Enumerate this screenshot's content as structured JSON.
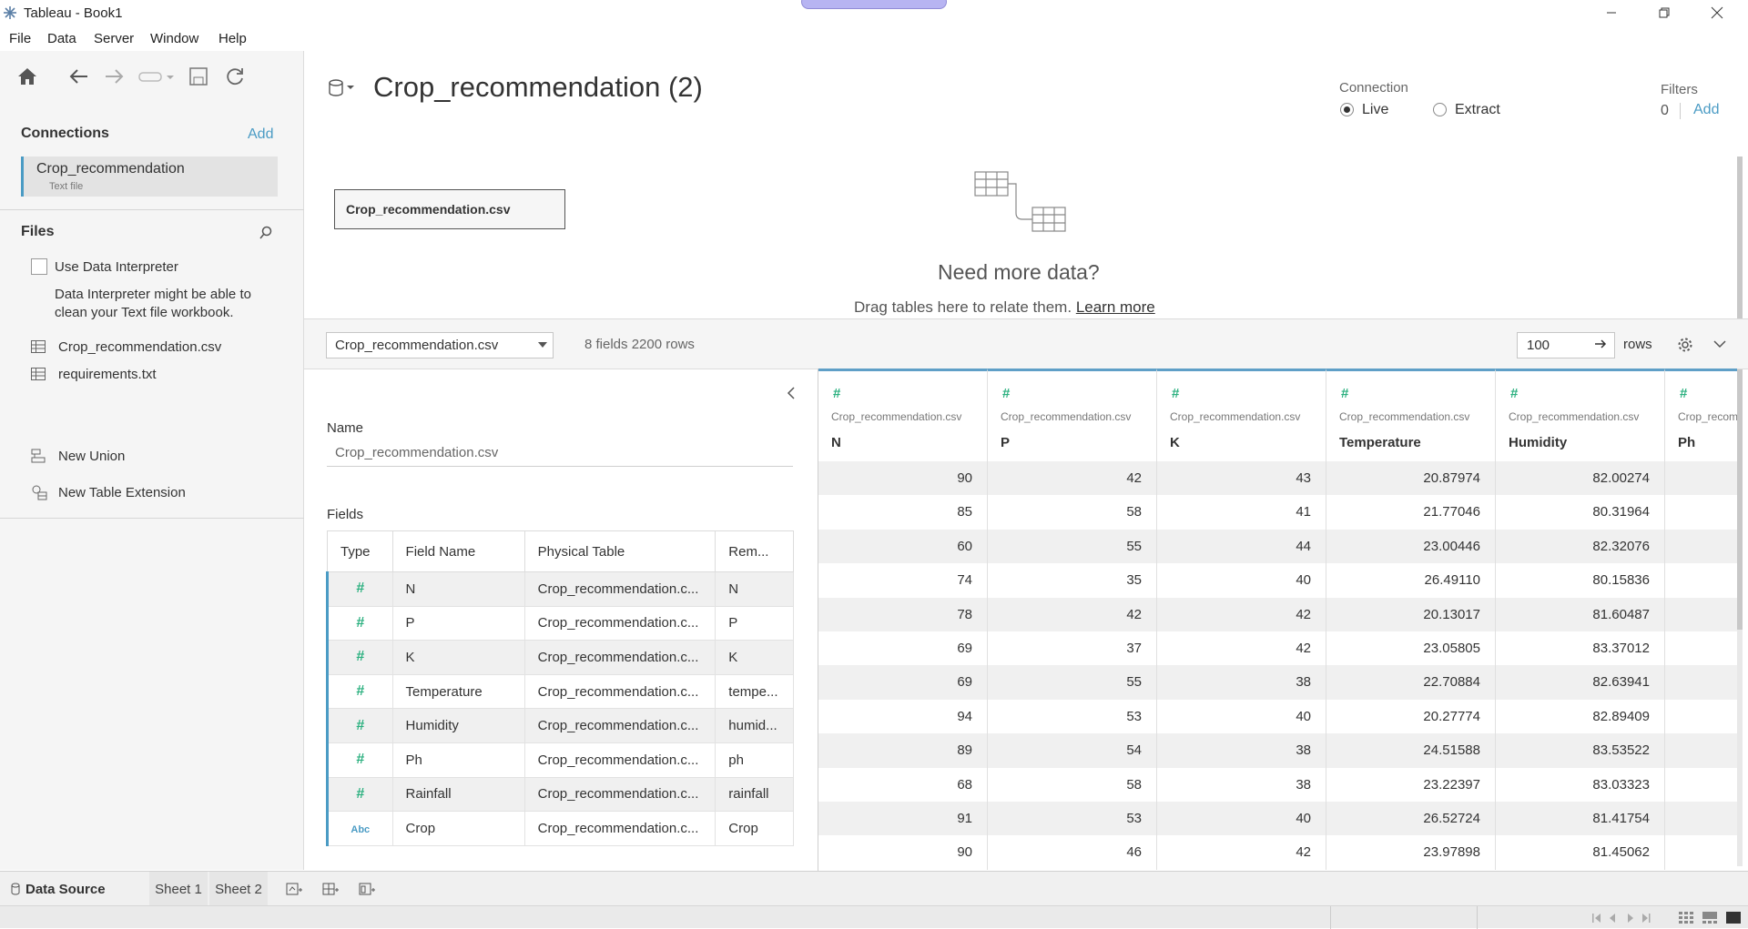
{
  "window": {
    "title": "Tableau - Book1"
  },
  "menu": [
    "File",
    "Data",
    "Server",
    "Window",
    "Help"
  ],
  "left": {
    "connections_title": "Connections",
    "add_label": "Add",
    "connection": {
      "name": "Crop_recommendation",
      "type": "Text file"
    },
    "files_title": "Files",
    "use_interpreter": "Use Data Interpreter",
    "interpreter_hint_line1": "Data Interpreter might be able to",
    "interpreter_hint_line2": "clean your Text file workbook.",
    "files": [
      "Crop_recommendation.csv",
      "requirements.txt"
    ],
    "new_union": "New Union",
    "new_table_extension": "New Table Extension"
  },
  "canvas": {
    "datasource_title": "Crop_recommendation (2)",
    "connection_label": "Connection",
    "live": "Live",
    "extract": "Extract",
    "filters_label": "Filters",
    "filters_count": "0",
    "filters_add": "Add",
    "table_name": "Crop_recommendation.csv",
    "need_more": "Need more data?",
    "drag_text": "Drag tables here to relate them.",
    "learn_more": "Learn more"
  },
  "gridbar": {
    "table_select": "Crop_recommendation.csv",
    "field_count": "8 fields 2200 rows",
    "rows_value": "100",
    "rows_label": "rows"
  },
  "meta": {
    "name_label": "Name",
    "name_value": "Crop_recommendation.csv",
    "fields_label": "Fields",
    "headers": [
      "Type",
      "Field Name",
      "Physical Table",
      "Rem..."
    ],
    "fields": [
      {
        "type": "#",
        "name": "N",
        "table": "Crop_recommendation.c...",
        "remote": "N"
      },
      {
        "type": "#",
        "name": "P",
        "table": "Crop_recommendation.c...",
        "remote": "P"
      },
      {
        "type": "#",
        "name": "K",
        "table": "Crop_recommendation.c...",
        "remote": "K"
      },
      {
        "type": "#",
        "name": "Temperature",
        "table": "Crop_recommendation.c...",
        "remote": "tempe..."
      },
      {
        "type": "#",
        "name": "Humidity",
        "table": "Crop_recommendation.c...",
        "remote": "humid..."
      },
      {
        "type": "#",
        "name": "Ph",
        "table": "Crop_recommendation.c...",
        "remote": "ph"
      },
      {
        "type": "#",
        "name": "Rainfall",
        "table": "Crop_recommendation.c...",
        "remote": "rainfall"
      },
      {
        "type": "Abc",
        "name": "Crop",
        "table": "Crop_recommendation.c...",
        "remote": "Crop"
      }
    ]
  },
  "grid": {
    "source": "Crop_recommendation.csv",
    "columns": [
      "N",
      "P",
      "K",
      "Temperature",
      "Humidity",
      "Ph"
    ],
    "rows": [
      [
        "90",
        "42",
        "43",
        "20.87974",
        "82.00274",
        ""
      ],
      [
        "85",
        "58",
        "41",
        "21.77046",
        "80.31964",
        ""
      ],
      [
        "60",
        "55",
        "44",
        "23.00446",
        "82.32076",
        ""
      ],
      [
        "74",
        "35",
        "40",
        "26.49110",
        "80.15836",
        ""
      ],
      [
        "78",
        "42",
        "42",
        "20.13017",
        "81.60487",
        ""
      ],
      [
        "69",
        "37",
        "42",
        "23.05805",
        "83.37012",
        ""
      ],
      [
        "69",
        "55",
        "38",
        "22.70884",
        "82.63941",
        ""
      ],
      [
        "94",
        "53",
        "40",
        "20.27774",
        "82.89409",
        ""
      ],
      [
        "89",
        "54",
        "38",
        "24.51588",
        "83.53522",
        ""
      ],
      [
        "68",
        "58",
        "38",
        "23.22397",
        "83.03323",
        ""
      ],
      [
        "91",
        "53",
        "40",
        "26.52724",
        "81.41754",
        ""
      ],
      [
        "90",
        "46",
        "42",
        "23.97898",
        "81.45062",
        ""
      ]
    ]
  },
  "tabs": [
    "Data Source",
    "Sheet 1",
    "Sheet 2"
  ]
}
